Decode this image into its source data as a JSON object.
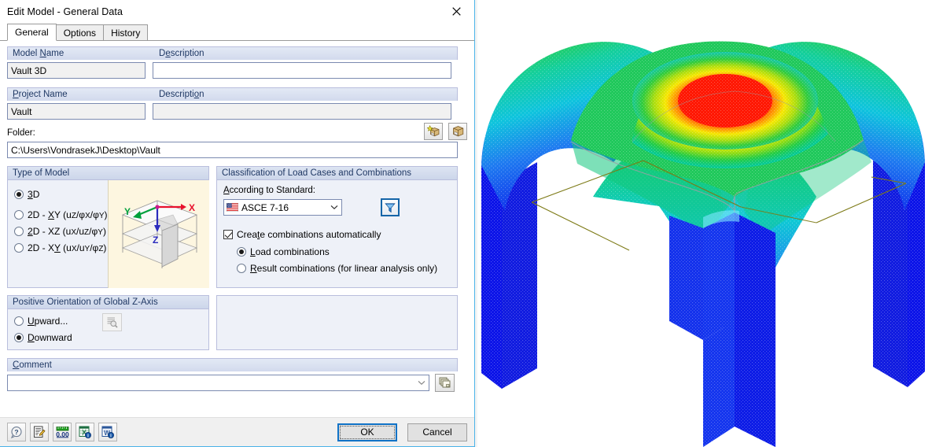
{
  "window": {
    "title": "Edit Model - General Data",
    "close_icon": "close-icon"
  },
  "tabs": [
    {
      "label": "General",
      "active": true
    },
    {
      "label": "Options",
      "active": false
    },
    {
      "label": "History",
      "active": false
    }
  ],
  "model_section": {
    "name_label": "Model Name",
    "name_label_pre": "Model ",
    "name_label_accel": "N",
    "name_label_post": "ame",
    "description_label_pre": "D",
    "description_label_accel": "e",
    "description_label_post": "scription",
    "description_label": "Description",
    "name_value": "Vault 3D",
    "description_value": "",
    "description_placeholder": ""
  },
  "project_section": {
    "name_label": "Project Name",
    "name_label_accel": "P",
    "name_label_post": "roject Name",
    "description_label": "Description",
    "description_label_pre": "Descripti",
    "description_label_accel": "o",
    "description_label_post": "n",
    "name_value": "Vault",
    "description_value": "",
    "folder_label": "Folder:",
    "folder_value": "C:\\Users\\VondrasekJ\\Desktop\\Vault",
    "new_project_button": "new-project-icon",
    "open_project_button": "open-project-icon"
  },
  "type_of_model": {
    "title": "Type of Model",
    "options": [
      {
        "label": "3D",
        "accel_pre": "",
        "accel": "3",
        "accel_post": "D",
        "selected": true
      },
      {
        "label": "2D - XY (uZ/φX/φY)",
        "accel_pre": "2D - ",
        "accel": "X",
        "accel_post": "Y (uZ/φX/φY)",
        "selected": false
      },
      {
        "label": "2D - XZ (uX/uZ/φY)",
        "accel_pre": "",
        "accel": "2",
        "accel_post": "D - XZ (uX/uZ/φY)",
        "selected": false
      },
      {
        "label": "2D - XY (uX/uY/φZ)",
        "accel_pre": "2D - X",
        "accel": "Y",
        "accel_post": " (uX/uY/φZ)",
        "selected": false
      }
    ],
    "preview": {
      "axis_x_label": "X",
      "axis_y_label": "Y",
      "axis_z_label": "Z",
      "axis_x_color": "#e8112d",
      "axis_y_color": "#00a03c",
      "axis_z_color": "#2b2bbd",
      "background": "#fdf6e0"
    }
  },
  "classification": {
    "title": "Classification of Load Cases and Combinations",
    "standard_label": "According to Standard:",
    "standard_label_accel": "A",
    "standard_label_post": "ccording to Standard:",
    "standard_value": "ASCE 7-16",
    "standard_flag": "us-flag-icon",
    "filter_button": "filter-icon",
    "create_combinations_label": "Create combinations automatically",
    "create_combinations_pre": "Crea",
    "create_combinations_accel": "t",
    "create_combinations_post": "e combinations automatically",
    "create_combinations_checked": true,
    "combination_options": [
      {
        "label": "Load combinations",
        "accel_pre": "",
        "accel": "L",
        "accel_post": "oad combinations",
        "selected": true
      },
      {
        "label": "Result combinations (for linear analysis only)",
        "accel_pre": "",
        "accel": "R",
        "accel_post": "esult combinations (for linear analysis only)",
        "selected": false
      }
    ]
  },
  "z_axis": {
    "title": "Positive Orientation of Global Z-Axis",
    "options": [
      {
        "label": "Upward...",
        "accel_pre": "",
        "accel": "U",
        "accel_post": "pward...",
        "selected": false
      },
      {
        "label": "Downward",
        "accel_pre": "",
        "accel": "D",
        "accel_post": "ownward",
        "selected": true
      }
    ],
    "preview_button": "preview-magnifier-icon"
  },
  "comment": {
    "label": "Comment",
    "label_accel": "C",
    "label_post": "omment",
    "value": "",
    "placeholder": "",
    "library_button": "comment-library-icon"
  },
  "toolbar": [
    {
      "name": "help-icon",
      "tooltip": "Help"
    },
    {
      "name": "notes-edit-icon",
      "tooltip": "Edit notes"
    },
    {
      "name": "units-icon",
      "tooltip": "Units and decimal places",
      "text": "0.00"
    },
    {
      "name": "excel-export-icon",
      "tooltip": "Export to Excel"
    },
    {
      "name": "word-export-icon",
      "tooltip": "Export to Word"
    }
  ],
  "buttons": {
    "ok": "OK",
    "cancel": "Cancel"
  },
  "viewport": {
    "name": "vault-3d-fea-result-view",
    "description": "FEA contour plot of a groin vault structure",
    "colors": {
      "max": "#ff0000",
      "high": "#ffa000",
      "mid_high": "#f2ea00",
      "mid": "#22cc22",
      "mid_low": "#00d0d0",
      "low": "#2080f0",
      "min": "#0000ee",
      "edge": "#808000"
    }
  }
}
